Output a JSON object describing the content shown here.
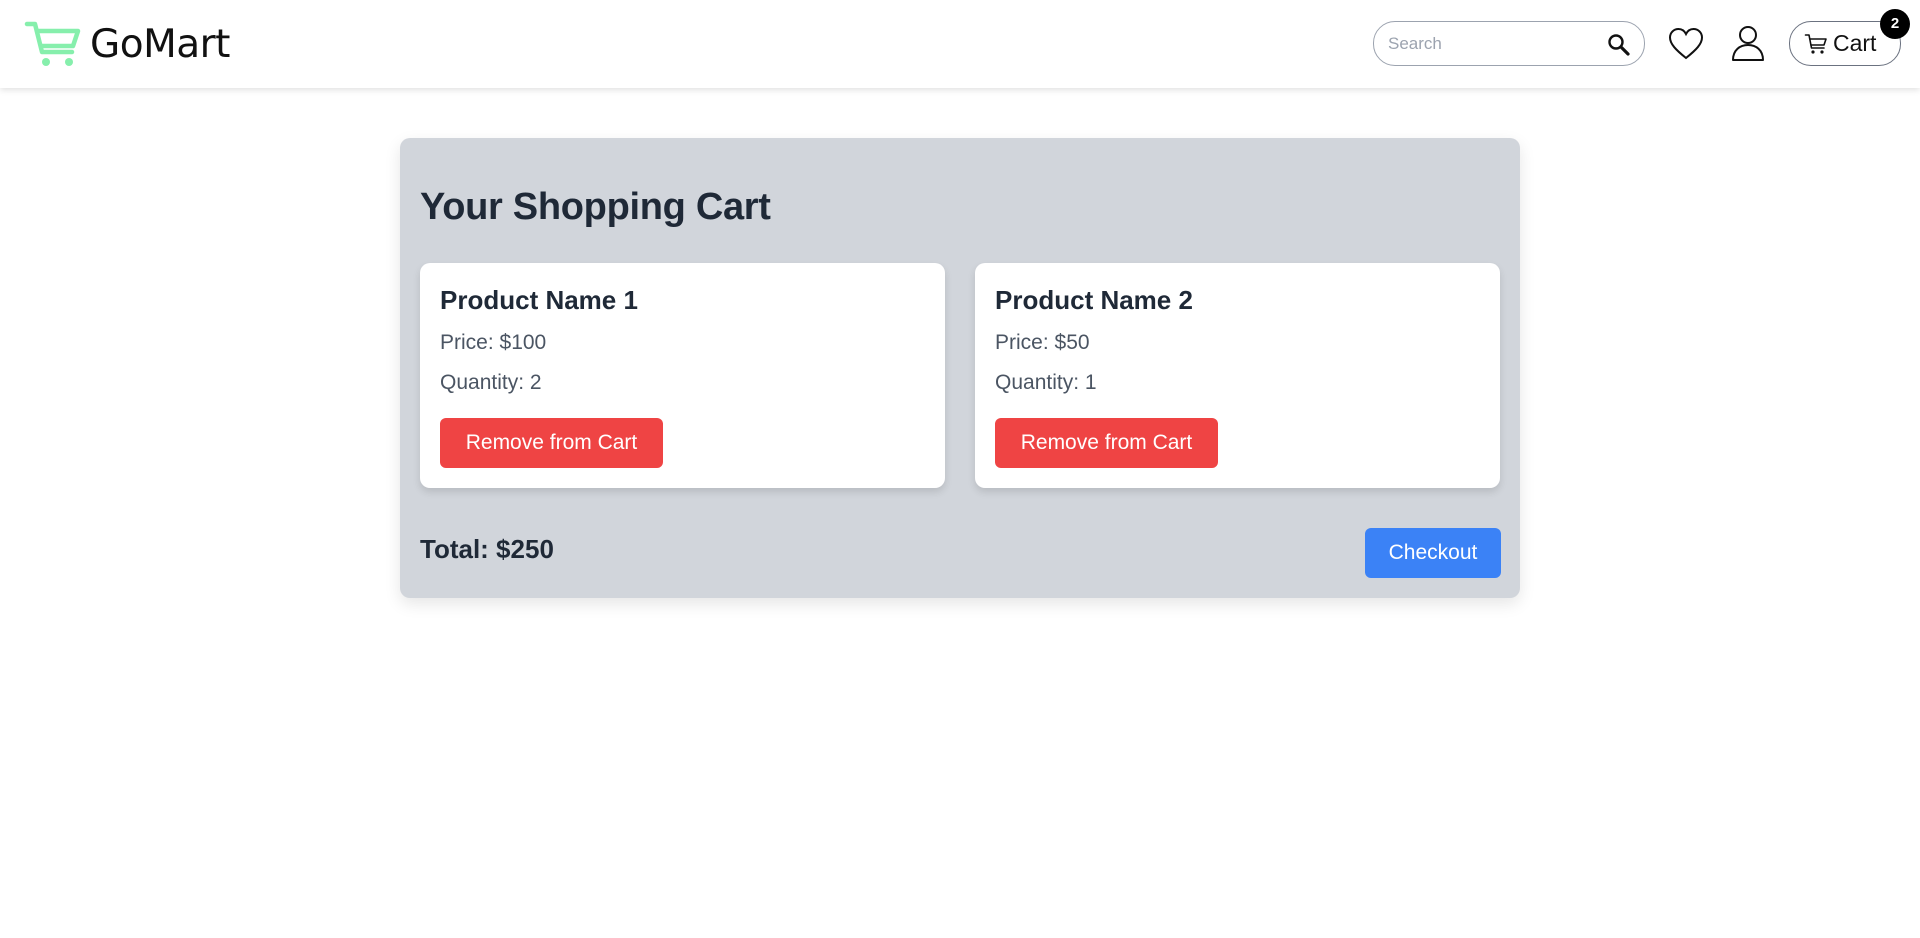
{
  "brand": {
    "name": "GoMart",
    "logo_icon": "shopping-cart-icon",
    "logo_color": "#86efac"
  },
  "header": {
    "search": {
      "placeholder": "Search",
      "value": "",
      "icon": "search-icon"
    },
    "wishlist_icon": "heart-icon",
    "account_icon": "user-icon",
    "cart_button": {
      "label": "Cart",
      "icon": "cart-icon",
      "badge_count": "2"
    }
  },
  "cart": {
    "title": "Your Shopping Cart",
    "items": [
      {
        "name": "Product Name 1",
        "price": "Price: $100",
        "quantity": "Quantity: 2",
        "remove_label": "Remove from Cart"
      },
      {
        "name": "Product Name 2",
        "price": "Price: $50",
        "quantity": "Quantity: 1",
        "remove_label": "Remove from Cart"
      }
    ],
    "total": "Total: $250",
    "checkout_label": "Checkout"
  },
  "colors": {
    "panel_bg": "#d1d5db",
    "remove_button": "#ef4444",
    "checkout_button": "#3b82f6",
    "badge": "#000000"
  }
}
